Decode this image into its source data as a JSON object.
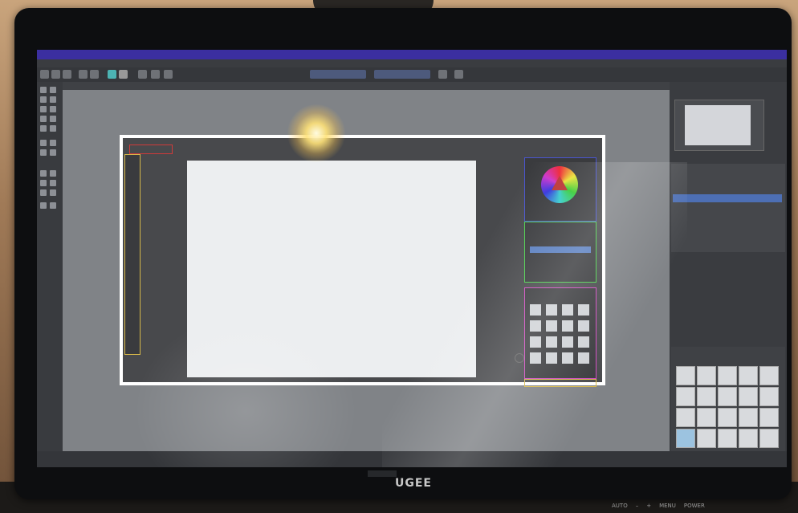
{
  "photo": {
    "brand_logo": "UGEE",
    "bezel_buttons": [
      "AUTO",
      "–",
      "+",
      "MENU",
      "POWER"
    ]
  },
  "icons": [
    "cursor-icon",
    "brush-icon",
    "eraser-icon",
    "rectangle-icon",
    "ellipse-icon",
    "color-wheel-icon"
  ]
}
